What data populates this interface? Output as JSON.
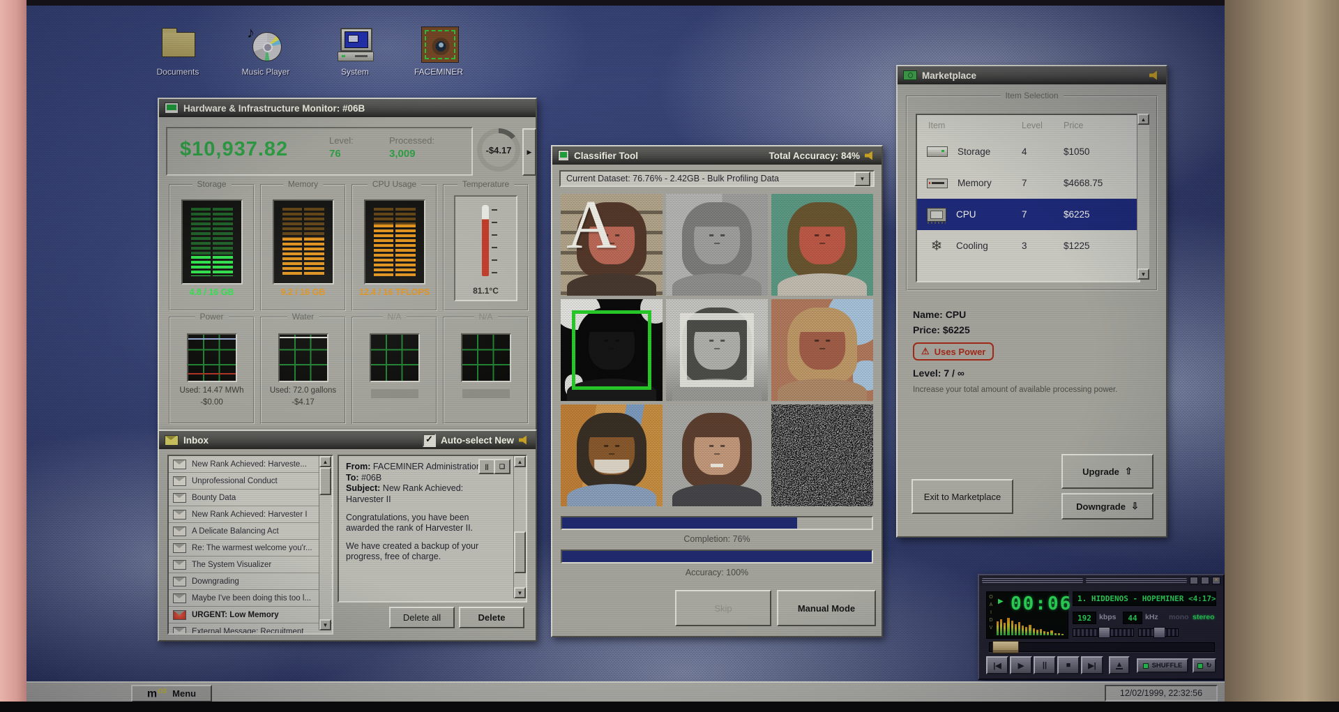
{
  "desktop": {
    "icons": [
      {
        "label": "Documents",
        "icon": "folder-icon"
      },
      {
        "label": "Music Player",
        "icon": "cd-icon"
      },
      {
        "label": "System",
        "icon": "computer-icon"
      },
      {
        "label": "FACEMINER",
        "icon": "eye-icon"
      }
    ]
  },
  "hardware_monitor": {
    "title": "Hardware & Infrastructure Monitor: #06B",
    "balance": "$10,937.82",
    "level_label": "Level:",
    "level_value": "76",
    "processed_label": "Processed:",
    "processed_value": "3,009",
    "rate": "-$4.17",
    "gauges": [
      {
        "name": "Storage",
        "type": "bars",
        "value": "4.8 / 16 GB",
        "color": "#2ee04a",
        "dim": "#1d6a28",
        "fill": 30
      },
      {
        "name": "Memory",
        "type": "bars",
        "value": "9.2 / 16 GB",
        "color": "#e2921a",
        "dim": "#7a5210",
        "fill": 56
      },
      {
        "name": "CPU Usage",
        "type": "bars",
        "value": "12.4 / 16 TFLOPS",
        "color": "#e2921a",
        "dim": "#7a5210",
        "fill": 76
      },
      {
        "name": "Temperature",
        "type": "thermo",
        "value": "81.1°C",
        "fill": 80
      }
    ],
    "meters": [
      {
        "name": "Power",
        "na": false,
        "line1": "Used: 14.47 MWh",
        "line2": "-$0.00",
        "lines": [
          "blue",
          "red"
        ]
      },
      {
        "name": "Water",
        "na": false,
        "line1": "Used: 72.0 gallons",
        "line2": "-$4.17",
        "lines": [
          "white"
        ]
      },
      {
        "name": "N/A",
        "na": true,
        "lines": []
      },
      {
        "name": "N/A",
        "na": true,
        "lines": []
      }
    ]
  },
  "inbox": {
    "title": "Inbox",
    "autoselect_label": "Auto-select New",
    "autoselect_checked": "✓",
    "emails": [
      "New Rank Achieved: Harveste...",
      "Unprofessional Conduct",
      "Bounty Data",
      "New Rank Achieved: Harvester I",
      "A Delicate Balancing Act",
      "Re: The warmest welcome you'r...",
      "The System Visualizer",
      "Downgrading",
      "Maybe I've been doing this too l...",
      "URGENT: Low Memory",
      "External Message: Recruitment"
    ],
    "urgent_index": 9,
    "message": {
      "from_label": "From:",
      "from": "FACEMINER Administration",
      "to_label": "To:",
      "to": "#06B",
      "subject_label": "Subject:",
      "subject": "New Rank Achieved: Harvester II",
      "body1": "Congratulations, you have been awarded the rank of Harvester II.",
      "body2": "We have created a backup of your progress, free of charge."
    },
    "pause_glyph": "||",
    "popout_glyph": "❏",
    "delete_all_label": "Delete all",
    "delete_label": "Delete"
  },
  "classifier": {
    "title": "Classifier Tool",
    "accuracy_title": "Total Accuracy: 84%",
    "dataset": "Current Dataset: 76.76% - 2.42GB - Bulk Profiling Data",
    "completion_label": "Completion: 76%",
    "completion_pct": 76,
    "accuracy_label": "Accuracy: 100%",
    "accuracy_pct": 100,
    "skip_label": "Skip",
    "manual_label": "Manual Mode",
    "overlay_letter": "A",
    "tiles": [
      {
        "desc": "woman red-tint, letter A overlay",
        "variant": "v-stripes",
        "overlay": "letter-a",
        "skin": "#bf6a58",
        "hair": "#55392a",
        "shirt": "#4a3a30"
      },
      {
        "desc": "grayscale woman",
        "variant": "v-grayface",
        "overlay": "none",
        "skin": "#a2a2a0",
        "hair": "#7e7e7c",
        "shirt": "#90908e"
      },
      {
        "desc": "woman on teal background",
        "variant": "v-teal",
        "overlay": "none",
        "skin": "#c05a48",
        "hair": "#6a5630",
        "shirt": "#c4beb2"
      },
      {
        "desc": "high-contrast man, green selection box",
        "variant": "v-bw",
        "overlay": "green-box",
        "skin": "#161616",
        "hair": "#0a0a0a",
        "shirt": "#1a1a1a"
      },
      {
        "desc": "grayscale young man, white selection box",
        "variant": "v-graylad",
        "overlay": "white-box",
        "skin": "#b2b2ae",
        "hair": "#4e4e4a",
        "shirt": "#9a9a96"
      },
      {
        "desc": "woman with sky background",
        "variant": "v-sky",
        "overlay": "none",
        "skin": "#a35f49",
        "hair": "#c09a68",
        "shirt": "#b08a68"
      },
      {
        "desc": "older man at storefront",
        "variant": "v-store",
        "overlay": "none",
        "skin": "#8a5a2e",
        "hair": "#3a3026",
        "shirt": "#8aa0bc"
      },
      {
        "desc": "smiling woman",
        "variant": "v-gray2",
        "overlay": "none",
        "skin": "#c69a7c",
        "hair": "#5e4030",
        "shirt": "#46464a"
      },
      {
        "desc": "static noise",
        "variant": "v-noise",
        "overlay": "noise",
        "skin": "",
        "hair": "",
        "shirt": ""
      }
    ]
  },
  "marketplace": {
    "title": "Marketplace",
    "section_title": "Item Selection",
    "columns": [
      "Item",
      "Level",
      "Price"
    ],
    "rows": [
      {
        "item": "Storage",
        "level": "4",
        "price": "$1050",
        "icon": "drive-icon",
        "selected": false
      },
      {
        "item": "Memory",
        "level": "7",
        "price": "$4668.75",
        "icon": "ram-icon",
        "selected": false
      },
      {
        "item": "CPU",
        "level": "7",
        "price": "$6225",
        "icon": "chip-icon",
        "selected": true
      },
      {
        "item": "Cooling",
        "level": "3",
        "price": "$1225",
        "icon": "snowflake-icon",
        "selected": false
      }
    ],
    "snowflake_glyph": "❄",
    "name_label": "Name:",
    "name": "CPU",
    "price_label": "Price:",
    "price": "$6225",
    "warning_glyph": "⚠",
    "uses_power": "Uses Power",
    "level_label": "Level:",
    "level": "7 / ∞",
    "description": "Increase your total amount of available processing power.",
    "upgrade_label": "Upgrade",
    "upgrade_glyph": "⇧",
    "exit_label": "Exit to Marketplace",
    "downgrade_label": "Downgrade",
    "downgrade_glyph": "⇩"
  },
  "player": {
    "time": "00:06",
    "play_glyph": "▶",
    "clutter": [
      "O",
      "A",
      "I",
      "D",
      "V"
    ],
    "track": "1. HIDDENOS - HOPEMINER <4:17>",
    "bitrate": "192",
    "bitrate_unit": "kbps",
    "samplerate": "44",
    "samplerate_unit": "kHz",
    "mono_label": "mono",
    "stereo_label": "stereo",
    "spectrum": [
      78,
      90,
      70,
      95,
      82,
      60,
      72,
      52,
      46,
      58,
      38,
      30,
      34,
      24,
      18,
      26,
      12,
      10,
      8
    ],
    "transport": [
      "|◀",
      "▶",
      "||",
      "■",
      "▶|"
    ],
    "eject_glyph": "▲",
    "shuffle_label": "SHUFFLE",
    "repeat_glyph": "↻",
    "close_glyph": "✕"
  },
  "taskbar": {
    "logo": "m",
    "logo_sup": "OS",
    "menu_label": "Menu",
    "datetime": "12/02/1999, 22:32:56"
  }
}
